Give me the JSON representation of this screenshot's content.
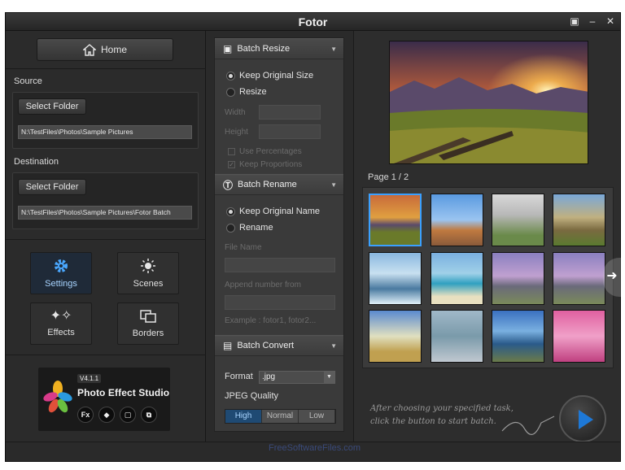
{
  "window": {
    "title": "Fotor"
  },
  "left": {
    "home_label": "Home",
    "source": {
      "label": "Source",
      "button": "Select Folder",
      "path": "N:\\TestFiles\\Photos\\Sample Pictures"
    },
    "destination": {
      "label": "Destination",
      "button": "Select Folder",
      "path": "N:\\TestFiles\\Photos\\Sample Pictures\\Fotor Batch"
    },
    "tools": [
      {
        "label": "Settings",
        "icon": "gear-icon",
        "active": true
      },
      {
        "label": "Scenes",
        "icon": "sun-icon"
      },
      {
        "label": "Effects",
        "icon": "sparkle-icon"
      },
      {
        "label": "Borders",
        "icon": "frames-icon"
      }
    ],
    "promo": {
      "version": "V4.1.1",
      "name": "Photo Effect Studio",
      "icons": [
        "Fx",
        "◆",
        "▢",
        "⧉"
      ]
    }
  },
  "middle": {
    "resize": {
      "title": "Batch Resize",
      "opt_keep": "Keep Original Size",
      "opt_resize": "Resize",
      "width_label": "Width",
      "height_label": "Height",
      "use_pct": "Use Percentages",
      "keep_prop": "Keep Proportions"
    },
    "rename": {
      "title": "Batch Rename",
      "opt_keep": "Keep Original Name",
      "opt_rename": "Rename",
      "file_name_label": "File Name",
      "append_label": "Append number from",
      "example": "Example : fotor1, fotor2..."
    },
    "convert": {
      "title": "Batch Convert",
      "format_label": "Format",
      "format_value": ".jpg",
      "quality_label": "JPEG Quality",
      "quality_options": [
        "High",
        "Normal",
        "Low"
      ]
    }
  },
  "right": {
    "page_label": "Page 1 / 2",
    "hint": "After choosing your specified task, click the button to start batch."
  },
  "watermark": "FreeSoftwareFiles.com"
}
